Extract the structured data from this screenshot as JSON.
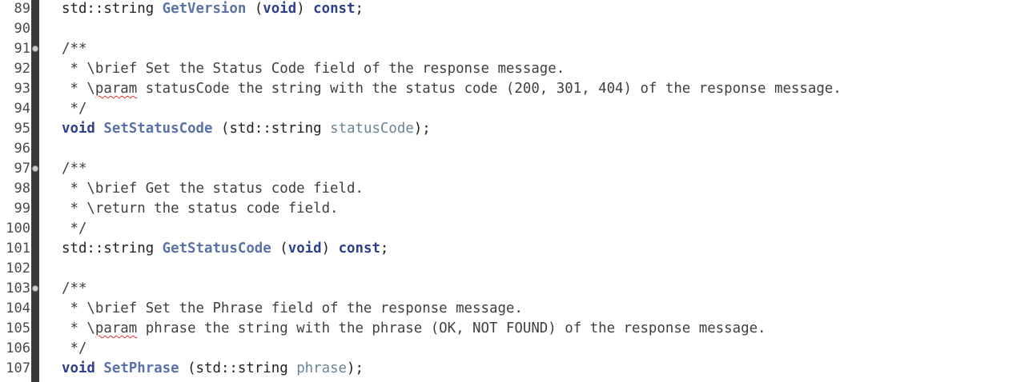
{
  "lines": [
    {
      "n": "89",
      "fold": false,
      "parts": [
        {
          "t": "std::string ",
          "c": "plain"
        },
        {
          "t": "GetVersion",
          "c": "fn"
        },
        {
          "t": " (",
          "c": "plain"
        },
        {
          "t": "void",
          "c": "kw"
        },
        {
          "t": ") ",
          "c": "plain"
        },
        {
          "t": "const",
          "c": "kw"
        },
        {
          "t": ";",
          "c": "plain"
        }
      ]
    },
    {
      "n": "90",
      "fold": false,
      "parts": []
    },
    {
      "n": "91",
      "fold": true,
      "parts": [
        {
          "t": "/**",
          "c": "cm"
        }
      ]
    },
    {
      "n": "92",
      "fold": false,
      "parts": [
        {
          "t": " * \\brief Set the Status Code field of the response message.",
          "c": "cm"
        }
      ]
    },
    {
      "n": "93",
      "fold": false,
      "parts": [
        {
          "t": " * \\",
          "c": "cm"
        },
        {
          "t": "param",
          "c": "cm spell"
        },
        {
          "t": " statusCode the string with the status code (200, 301, 404) of the response message.",
          "c": "cm"
        }
      ]
    },
    {
      "n": "94",
      "fold": false,
      "parts": [
        {
          "t": " */",
          "c": "cm"
        }
      ]
    },
    {
      "n": "95",
      "fold": false,
      "parts": [
        {
          "t": "void",
          "c": "kw"
        },
        {
          "t": " ",
          "c": "plain"
        },
        {
          "t": "SetStatusCode",
          "c": "fn"
        },
        {
          "t": " (std::string ",
          "c": "plain"
        },
        {
          "t": "statusCode",
          "c": "param"
        },
        {
          "t": ");",
          "c": "plain"
        }
      ]
    },
    {
      "n": "96",
      "fold": false,
      "parts": []
    },
    {
      "n": "97",
      "fold": true,
      "parts": [
        {
          "t": "/**",
          "c": "cm"
        }
      ]
    },
    {
      "n": "98",
      "fold": false,
      "parts": [
        {
          "t": " * \\brief Get the status code field.",
          "c": "cm"
        }
      ]
    },
    {
      "n": "99",
      "fold": false,
      "parts": [
        {
          "t": " * \\return the status code field.",
          "c": "cm"
        }
      ]
    },
    {
      "n": "100",
      "fold": false,
      "parts": [
        {
          "t": " */",
          "c": "cm"
        }
      ]
    },
    {
      "n": "101",
      "fold": false,
      "parts": [
        {
          "t": "std::string ",
          "c": "plain"
        },
        {
          "t": "GetStatusCode",
          "c": "fn"
        },
        {
          "t": " (",
          "c": "plain"
        },
        {
          "t": "void",
          "c": "kw"
        },
        {
          "t": ") ",
          "c": "plain"
        },
        {
          "t": "const",
          "c": "kw"
        },
        {
          "t": ";",
          "c": "plain"
        }
      ]
    },
    {
      "n": "102",
      "fold": false,
      "parts": []
    },
    {
      "n": "103",
      "fold": true,
      "parts": [
        {
          "t": "/**",
          "c": "cm"
        }
      ]
    },
    {
      "n": "104",
      "fold": false,
      "parts": [
        {
          "t": " * \\brief Set the Phrase field of the response message.",
          "c": "cm"
        }
      ]
    },
    {
      "n": "105",
      "fold": false,
      "parts": [
        {
          "t": " * \\",
          "c": "cm"
        },
        {
          "t": "param",
          "c": "cm spell"
        },
        {
          "t": " phrase the string with the phrase (OK, NOT FOUND) of the response message.",
          "c": "cm"
        }
      ]
    },
    {
      "n": "106",
      "fold": false,
      "parts": [
        {
          "t": " */",
          "c": "cm"
        }
      ]
    },
    {
      "n": "107",
      "fold": false,
      "parts": [
        {
          "t": "void",
          "c": "kw"
        },
        {
          "t": " ",
          "c": "plain"
        },
        {
          "t": "SetPhrase",
          "c": "fn"
        },
        {
          "t": " (std::string ",
          "c": "plain"
        },
        {
          "t": "phrase",
          "c": "param"
        },
        {
          "t": ");",
          "c": "plain"
        }
      ]
    }
  ],
  "colors": {
    "background": "#ffffff",
    "gutter_bar": "#3a3a3a",
    "line_number": "#4a4a4a",
    "keyword": "#2e3f8c",
    "function_name": "#5a72a8",
    "parameter": "#6a8696",
    "comment": "#3f3f3f",
    "spell_error": "#d7302a"
  }
}
